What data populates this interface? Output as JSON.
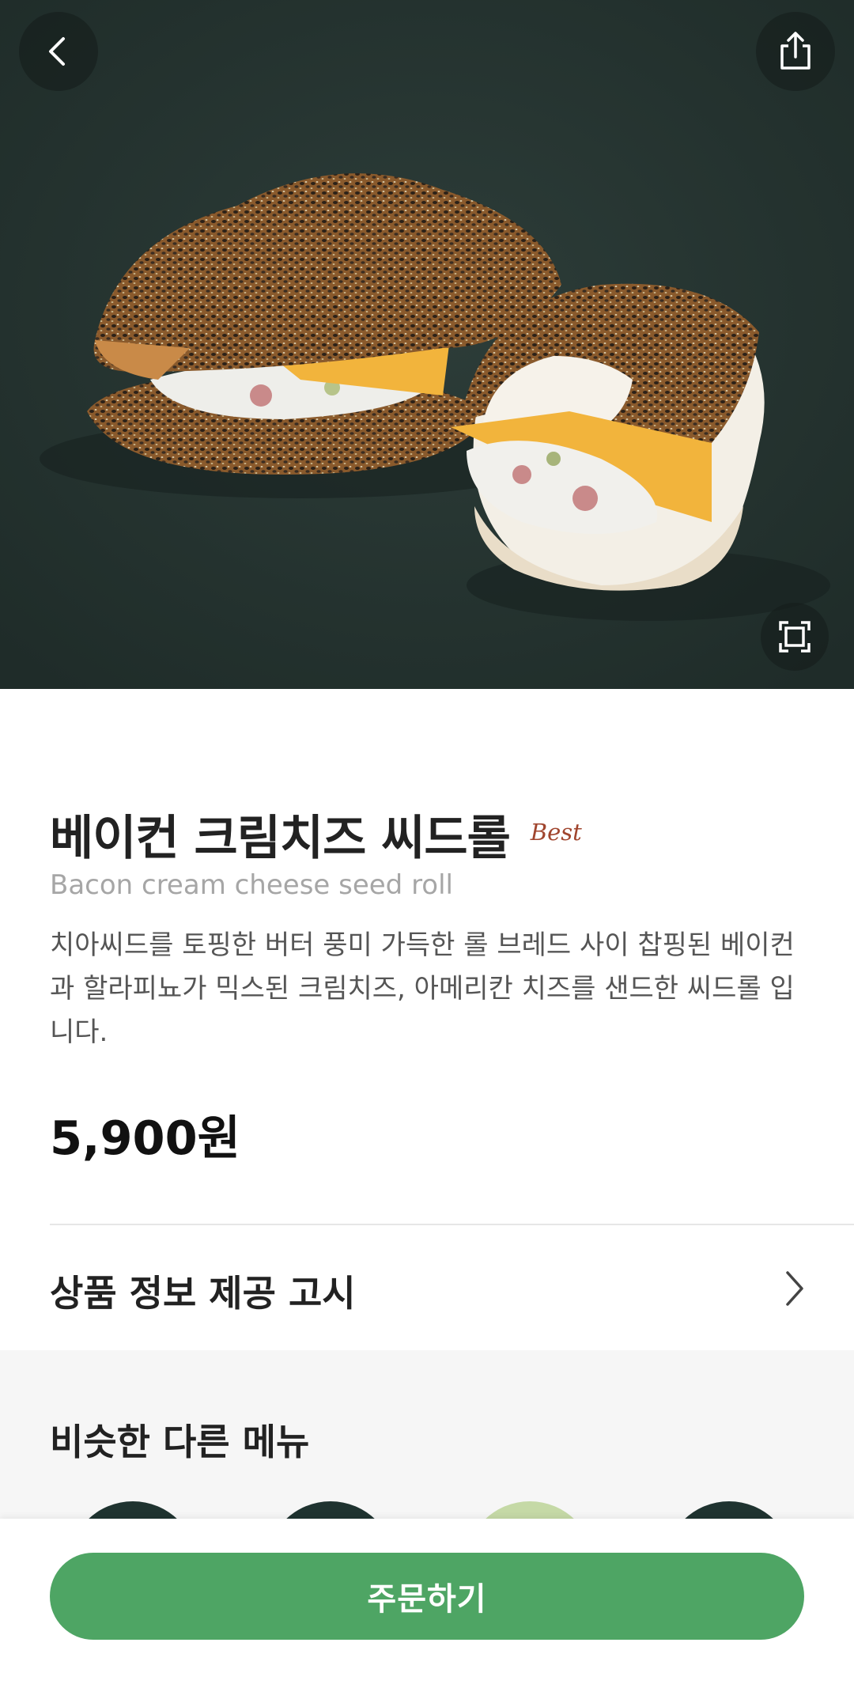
{
  "product": {
    "name_ko": "베이컨 크림치즈 씨드롤",
    "badge": "Best",
    "name_en": "Bacon cream cheese seed roll",
    "description": "치아씨드를 토핑한 버터 풍미 가득한 롤 브레드 사이 찹핑된 베이컨과 할라피뇨가 믹스된 크림치즈, 아메리칸 치즈를 샌드한 씨드롤 입니다.",
    "price": "5,900원"
  },
  "info_notice": {
    "label": "상품 정보 제공 고시"
  },
  "similar": {
    "title": "비슷한 다른 메뉴",
    "items": [
      {
        "color": "#1f3330"
      },
      {
        "color": "#1f3330"
      },
      {
        "color": "#c5d9a6"
      },
      {
        "color": "#1f3330"
      }
    ]
  },
  "order_button": {
    "label": "주문하기"
  },
  "colors": {
    "hero_bg": "#253431",
    "accent": "#4ea564",
    "badge": "#a0452e"
  },
  "icons": {
    "back": "chevron-left-icon",
    "share": "share-icon",
    "expand": "expand-icon",
    "info_chevron": "chevron-right-icon"
  }
}
